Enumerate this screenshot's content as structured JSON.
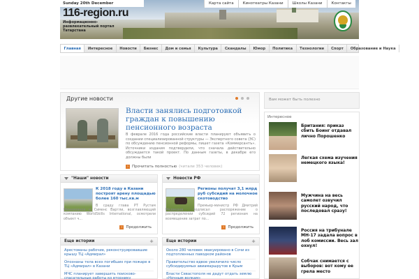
{
  "header": {
    "date": "Sunday 20th December",
    "logo": "116-region.ru",
    "slogan": "Информационно-развлекательный портал Татарстана",
    "topmenu": [
      "Карта сайта",
      "Кинотеатры Казани",
      "Школы Казани",
      "Контакты"
    ]
  },
  "nav": [
    "Главная",
    "Интересное",
    "Новости",
    "Бизнес",
    "Дом и семья",
    "Культура",
    "Скандалы",
    "Юмор",
    "Политика",
    "Технологии",
    "Спорт",
    "Образование и Наука"
  ],
  "slider": {
    "title": "Другие новости",
    "headline": "Власти занялись подготовкой граждан к повышению пенсионного возраста",
    "text": "В феврале 2016 года российские власти планируют объявить о создании специализированной структуры — Экспертного совета (ЭС) по обсуждению пенсионной реформы, пишет газета «Коммерсантъ». Источники издания подтвердили, что сначала действительно обсуждается такой проект. По данным газеты, в декабре его должны были",
    "readmore": "Прочитать полностью",
    "views": "(читали 353 человек)"
  },
  "box1": {
    "head": "\"Наши\" новости",
    "title": "К 2018 году в Казани построят арену площадью более 160 тыс.кв.м",
    "text": "В сраду глава РТ Рустам Минниханов и Сименс Вартли, возглавляющий компанию WorldSkills International, осмотрели объект ч...",
    "more": "Продолжить"
  },
  "box2": {
    "head": "Новости РФ",
    "title": "Регионы получат 3,1 млрд руб субсидий на молочное скотоводство",
    "text": "Премьер-министр РФ Дмитрий Медведев подписал распоряжение о распределении субсидий 72 регионам на возмещение затрат по...",
    "more": "Продолжить"
  },
  "more1": {
    "head": "Еще истории",
    "items": [
      "Арестованы рабочие, реконструировавшие крышу ТЦ «Адмирал»",
      "Опознаны тела всех погибших при пожаре в ТЦ «Адмирал» в Казани",
      "МЧС планирует завершить поисково-спасательные работы ко вторнику"
    ]
  },
  "more2": {
    "head": "Еще истории",
    "items": [
      "Около 280 человек эвакуировано в Сочи из подтопленных паводком районов",
      "Правительство вдвое увеличило число субсидируемых авиамаршрутов в Крым",
      "Власти Севастополя не дадут отдать землю «Ночным волкам»"
    ]
  },
  "sidebar": {
    "ad_text": "Вам может быть полезно",
    "label": "Интересное",
    "items": [
      "Британия: приказ сбить Боинг отдавал лично Порошенко",
      "Легкая схема изучения немецкого языка!",
      "Мужчина на весь самолет озвучил русский народ, что последовал сразу!",
      "Россия на трибунале МН-17 задала вопрос в лоб комиссии. Весь зал охнул!",
      "Собчак снимается с выборов: вот кому ее грела место"
    ]
  },
  "colors": {
    "link": "#2a6db5",
    "accent": "#e07b2a"
  }
}
